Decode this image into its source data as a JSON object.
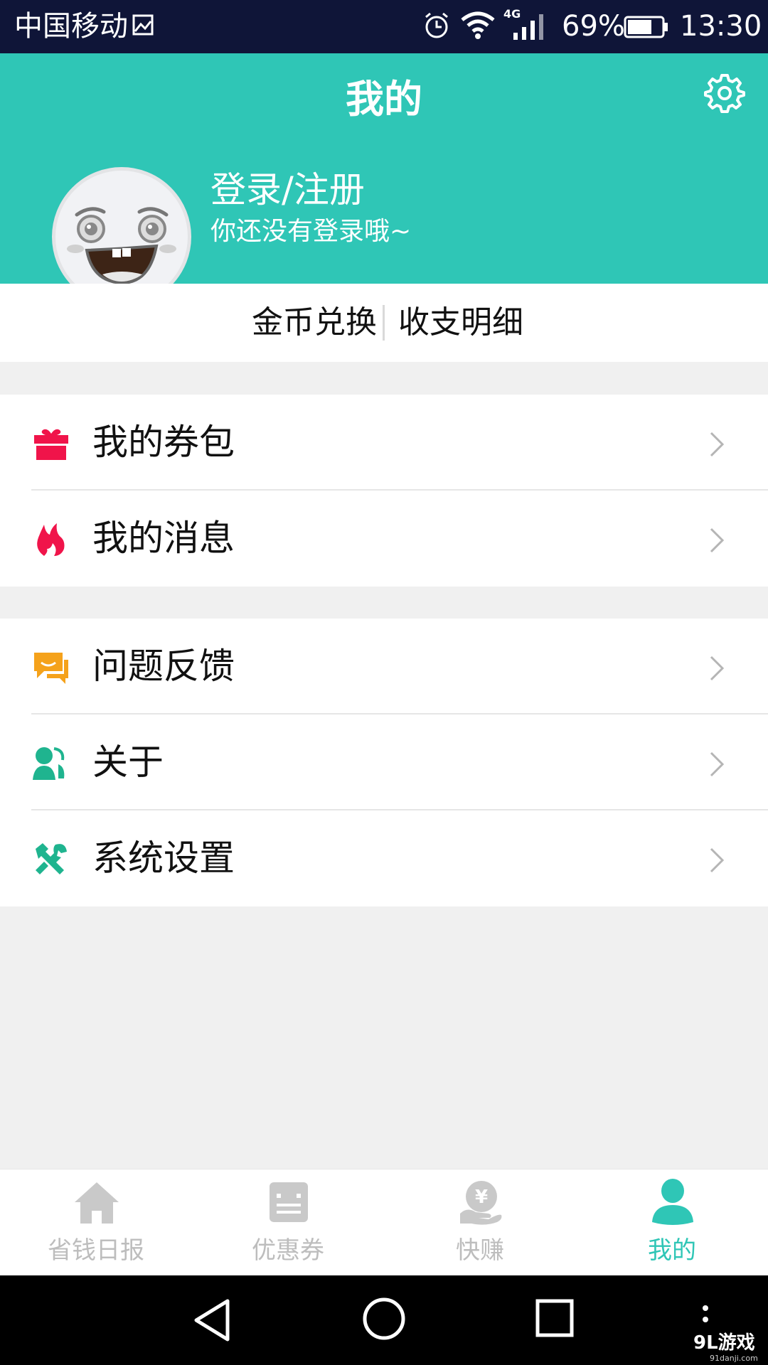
{
  "status_bar": {
    "carrier": "中国移动",
    "network": "4G",
    "battery_percent": "69%",
    "time": "13:30"
  },
  "header": {
    "title": "我的",
    "login_title": "登录/注册",
    "login_subtitle": "你还没有登录哦~"
  },
  "coins": {
    "exchange": "金币兑换",
    "details": "收支明细"
  },
  "menu": {
    "group1": [
      {
        "label": "我的券包",
        "icon": "gift-icon",
        "color": "#f0144a"
      },
      {
        "label": "我的消息",
        "icon": "flame-icon",
        "color": "#f0144a"
      }
    ],
    "group2": [
      {
        "label": "问题反馈",
        "icon": "feedback-icon",
        "color": "#f5a21b"
      },
      {
        "label": "关于",
        "icon": "about-icon",
        "color": "#1fb48f"
      },
      {
        "label": "系统设置",
        "icon": "tools-icon",
        "color": "#1fb48f"
      }
    ]
  },
  "bottom_nav": [
    {
      "label": "省钱日报",
      "icon": "home-icon",
      "active": false
    },
    {
      "label": "优惠券",
      "icon": "coupon-icon",
      "active": false
    },
    {
      "label": "快赚",
      "icon": "money-hand-icon",
      "active": false
    },
    {
      "label": "我的",
      "icon": "person-icon",
      "active": true
    }
  ],
  "watermark": {
    "brand": "9L游戏",
    "url": "91danji.com"
  },
  "colors": {
    "accent": "#2fc6b6",
    "status_bar": "#0f1538",
    "inactive": "#bdbdbd"
  }
}
